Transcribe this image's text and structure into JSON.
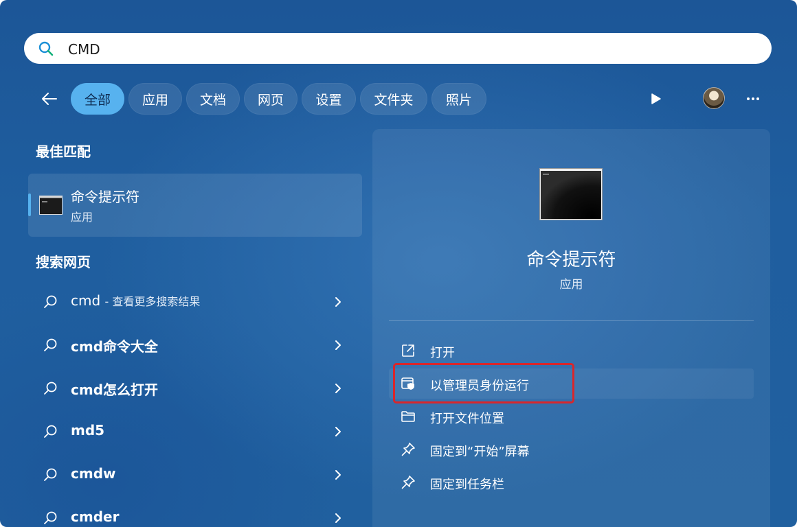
{
  "search": {
    "value": "CMD",
    "placeholder": ""
  },
  "filters": [
    {
      "label": "全部",
      "active": true
    },
    {
      "label": "应用"
    },
    {
      "label": "文档"
    },
    {
      "label": "网页"
    },
    {
      "label": "设置"
    },
    {
      "label": "文件夹"
    },
    {
      "label": "照片"
    }
  ],
  "best_match": {
    "heading": "最佳匹配",
    "name": "命令提示符",
    "type": "应用"
  },
  "web_search": {
    "heading": "搜索网页",
    "items": [
      {
        "query": "cmd",
        "suffix": "- 查看更多搜索结果"
      },
      {
        "query": "cmd命令大全"
      },
      {
        "query": "cmd怎么打开"
      },
      {
        "query": "md5"
      },
      {
        "query": "cmdw"
      },
      {
        "query": "cmder"
      }
    ]
  },
  "detail": {
    "name": "命令提示符",
    "type": "应用",
    "actions": [
      {
        "label": "打开",
        "icon": "open-external-icon"
      },
      {
        "label": "以管理员身份运行",
        "icon": "admin-shield-icon"
      },
      {
        "label": "打开文件位置",
        "icon": "folder-icon"
      },
      {
        "label": "固定到“开始”屏幕",
        "icon": "pin-icon"
      },
      {
        "label": "固定到任务栏",
        "icon": "pin-icon"
      }
    ]
  },
  "colors": {
    "accent": "#57b2ef",
    "highlight_box": "#d9262b",
    "background": "#1f5e9f"
  }
}
